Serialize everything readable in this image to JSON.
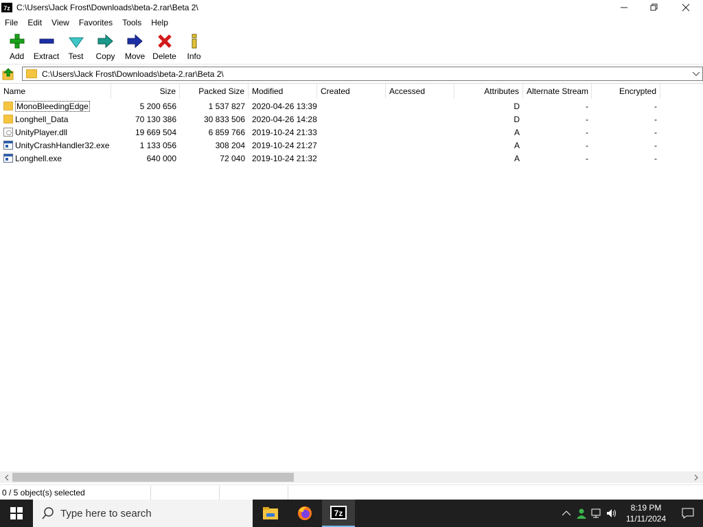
{
  "window": {
    "app_icon_text": "7z",
    "title": "C:\\Users\\Jack Frost\\Downloads\\beta-2.rar\\Beta 2\\",
    "controls": {
      "minimize": "—",
      "maximize": "❐",
      "close": "✕"
    }
  },
  "menu": [
    "File",
    "Edit",
    "View",
    "Favorites",
    "Tools",
    "Help"
  ],
  "toolbar": [
    {
      "label": "Add",
      "icon": "plus-icon",
      "color": "#1aa31a"
    },
    {
      "label": "Extract",
      "icon": "minus-icon",
      "color": "#1c2fa6"
    },
    {
      "label": "Test",
      "icon": "check-icon",
      "color": "#1aa6a6"
    },
    {
      "label": "Copy",
      "icon": "double-arrow-icon",
      "color": "#1a8a5a"
    },
    {
      "label": "Move",
      "icon": "arrow-right-icon",
      "color": "#1c2fa6"
    },
    {
      "label": "Delete",
      "icon": "x-icon",
      "color": "#d21a1a"
    },
    {
      "label": "Info",
      "icon": "info-icon",
      "color": "#c9a21a"
    }
  ],
  "address": {
    "path": "C:\\Users\\Jack Frost\\Downloads\\beta-2.rar\\Beta 2\\"
  },
  "columns": [
    "Name",
    "Size",
    "Packed Size",
    "Modified",
    "Created",
    "Accessed",
    "Attributes",
    "Alternate Stream",
    "Encrypted"
  ],
  "files": [
    {
      "name": "MonoBleedingEdge",
      "type": "folder",
      "size": "5 200 656",
      "packed": "1 537 827",
      "modified": "2020-04-26 13:39",
      "created": "",
      "accessed": "",
      "attributes": "D",
      "alt_stream": "-",
      "encrypted": "-"
    },
    {
      "name": "Longhell_Data",
      "type": "folder",
      "size": "70 130 386",
      "packed": "30 833 506",
      "modified": "2020-04-26 14:28",
      "created": "",
      "accessed": "",
      "attributes": "D",
      "alt_stream": "-",
      "encrypted": "-"
    },
    {
      "name": "UnityPlayer.dll",
      "type": "dll",
      "size": "19 669 504",
      "packed": "6 859 766",
      "modified": "2019-10-24 21:33",
      "created": "",
      "accessed": "",
      "attributes": "A",
      "alt_stream": "-",
      "encrypted": "-"
    },
    {
      "name": "UnityCrashHandler32.exe",
      "type": "exe",
      "size": "1 133 056",
      "packed": "308 204",
      "modified": "2019-10-24 21:27",
      "created": "",
      "accessed": "",
      "attributes": "A",
      "alt_stream": "-",
      "encrypted": "-"
    },
    {
      "name": "Longhell.exe",
      "type": "exe",
      "size": "640 000",
      "packed": "72 040",
      "modified": "2019-10-24 21:32",
      "created": "",
      "accessed": "",
      "attributes": "A",
      "alt_stream": "-",
      "encrypted": "-"
    }
  ],
  "status": {
    "selection": "0 / 5 object(s) selected"
  },
  "taskbar": {
    "search_placeholder": "Type here to search",
    "time": "8:19 PM",
    "date": "11/11/2024",
    "apps": [
      "file-explorer",
      "firefox",
      "7-zip"
    ]
  }
}
